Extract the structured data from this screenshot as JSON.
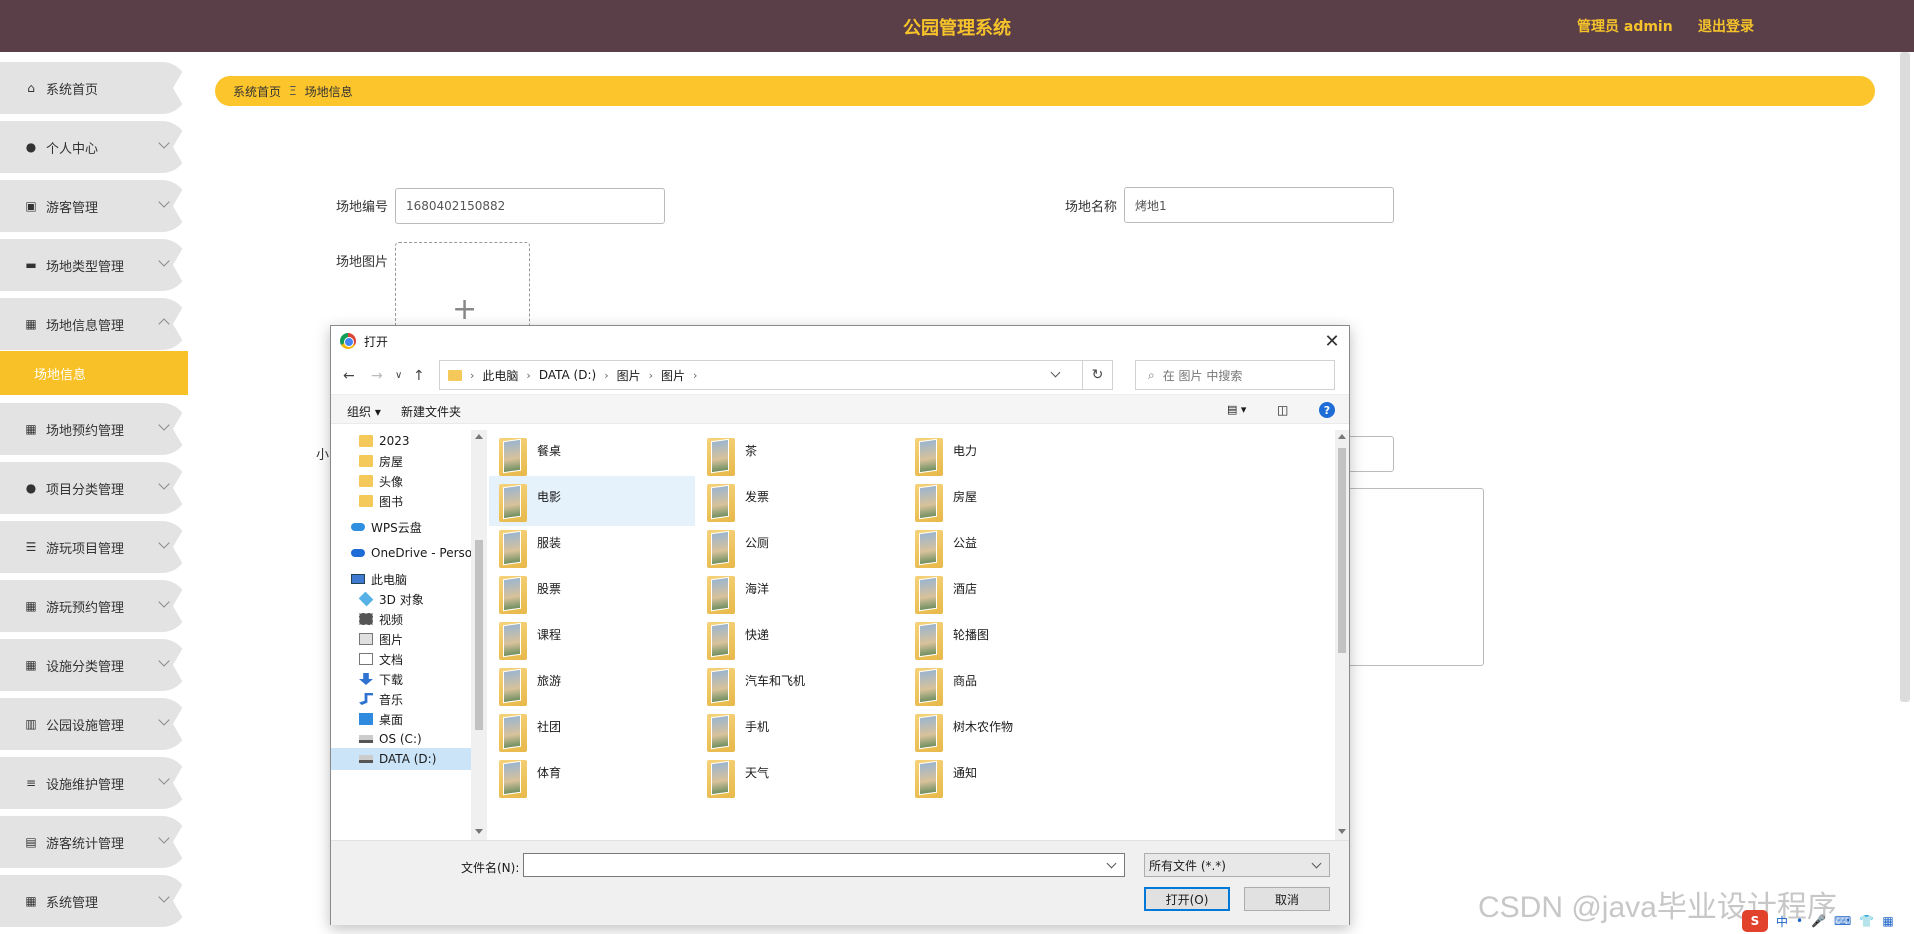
{
  "header": {
    "title": "公园管理系统",
    "admin_label": "管理员 admin",
    "logout_label": "退出登录"
  },
  "sidebar": {
    "items": [
      {
        "label": "系统首页",
        "icon": "home-icon"
      },
      {
        "label": "个人中心",
        "icon": "user-icon"
      },
      {
        "label": "游客管理",
        "icon": "id-card-icon"
      },
      {
        "label": "场地类型管理",
        "icon": "monitor-icon"
      },
      {
        "label": "场地信息管理",
        "icon": "grid-icon"
      },
      {
        "label": "场地预约管理",
        "icon": "grid-icon"
      },
      {
        "label": "项目分类管理",
        "icon": "user-icon"
      },
      {
        "label": "游玩项目管理",
        "icon": "list-icon"
      },
      {
        "label": "游玩预约管理",
        "icon": "grid-icon"
      },
      {
        "label": "设施分类管理",
        "icon": "grid-icon"
      },
      {
        "label": "公园设施管理",
        "icon": "bar-chart-icon"
      },
      {
        "label": "设施维护管理",
        "icon": "sliders-icon"
      },
      {
        "label": "游客统计管理",
        "icon": "briefcase-icon"
      },
      {
        "label": "系统管理",
        "icon": "grid-icon"
      }
    ],
    "active_sub": "场地信息"
  },
  "breadcrumb": {
    "home": "系统首页",
    "separator": "Ξ",
    "current": "场地信息"
  },
  "form": {
    "code_label": "场地编号",
    "code_value": "1680402150882",
    "name_label": "场地名称",
    "name_value": "烤地1",
    "image_label": "场地图片",
    "partial_label": "小"
  },
  "dialog": {
    "title": "打开",
    "path": [
      "此电脑",
      "DATA (D:)",
      "图片",
      "图片"
    ],
    "search_placeholder": "在 图片 中搜索",
    "organize_label": "组织 ▾",
    "new_folder_label": "新建文件夹",
    "nav_tree": [
      {
        "label": "2023",
        "icon": "folder-icon"
      },
      {
        "label": "房屋",
        "icon": "folder-icon"
      },
      {
        "label": "头像",
        "icon": "folder-icon"
      },
      {
        "label": "图书",
        "icon": "folder-icon"
      },
      {
        "label": "WPS云盘",
        "icon": "cloud-icon"
      },
      {
        "label": "OneDrive - Perso",
        "icon": "onedrive-icon"
      },
      {
        "label": "此电脑",
        "icon": "computer-icon"
      },
      {
        "label": "3D 对象",
        "icon": "cube-icon"
      },
      {
        "label": "视频",
        "icon": "video-icon"
      },
      {
        "label": "图片",
        "icon": "picture-icon"
      },
      {
        "label": "文档",
        "icon": "document-icon"
      },
      {
        "label": "下载",
        "icon": "download-icon"
      },
      {
        "label": "音乐",
        "icon": "music-icon"
      },
      {
        "label": "桌面",
        "icon": "desktop-icon"
      },
      {
        "label": "OS (C:)",
        "icon": "drive-icon"
      },
      {
        "label": "DATA (D:)",
        "icon": "drive-icon"
      }
    ],
    "files": [
      "餐桌",
      "茶",
      "电力",
      "电影",
      "发票",
      "房屋",
      "服装",
      "公厕",
      "公益",
      "股票",
      "海洋",
      "酒店",
      "课程",
      "快递",
      "轮播图",
      "旅游",
      "汽车和飞机",
      "商品",
      "社团",
      "手机",
      "树木农作物",
      "体育",
      "天气",
      "通知"
    ],
    "filename_label": "文件名(N):",
    "filename_value": "",
    "filetype_value": "所有文件 (*.*)",
    "open_label": "打开(O)",
    "cancel_label": "取消"
  },
  "watermark": "CSDN @java毕业设计程序",
  "ime": {
    "logo": "S",
    "lang": "中"
  }
}
